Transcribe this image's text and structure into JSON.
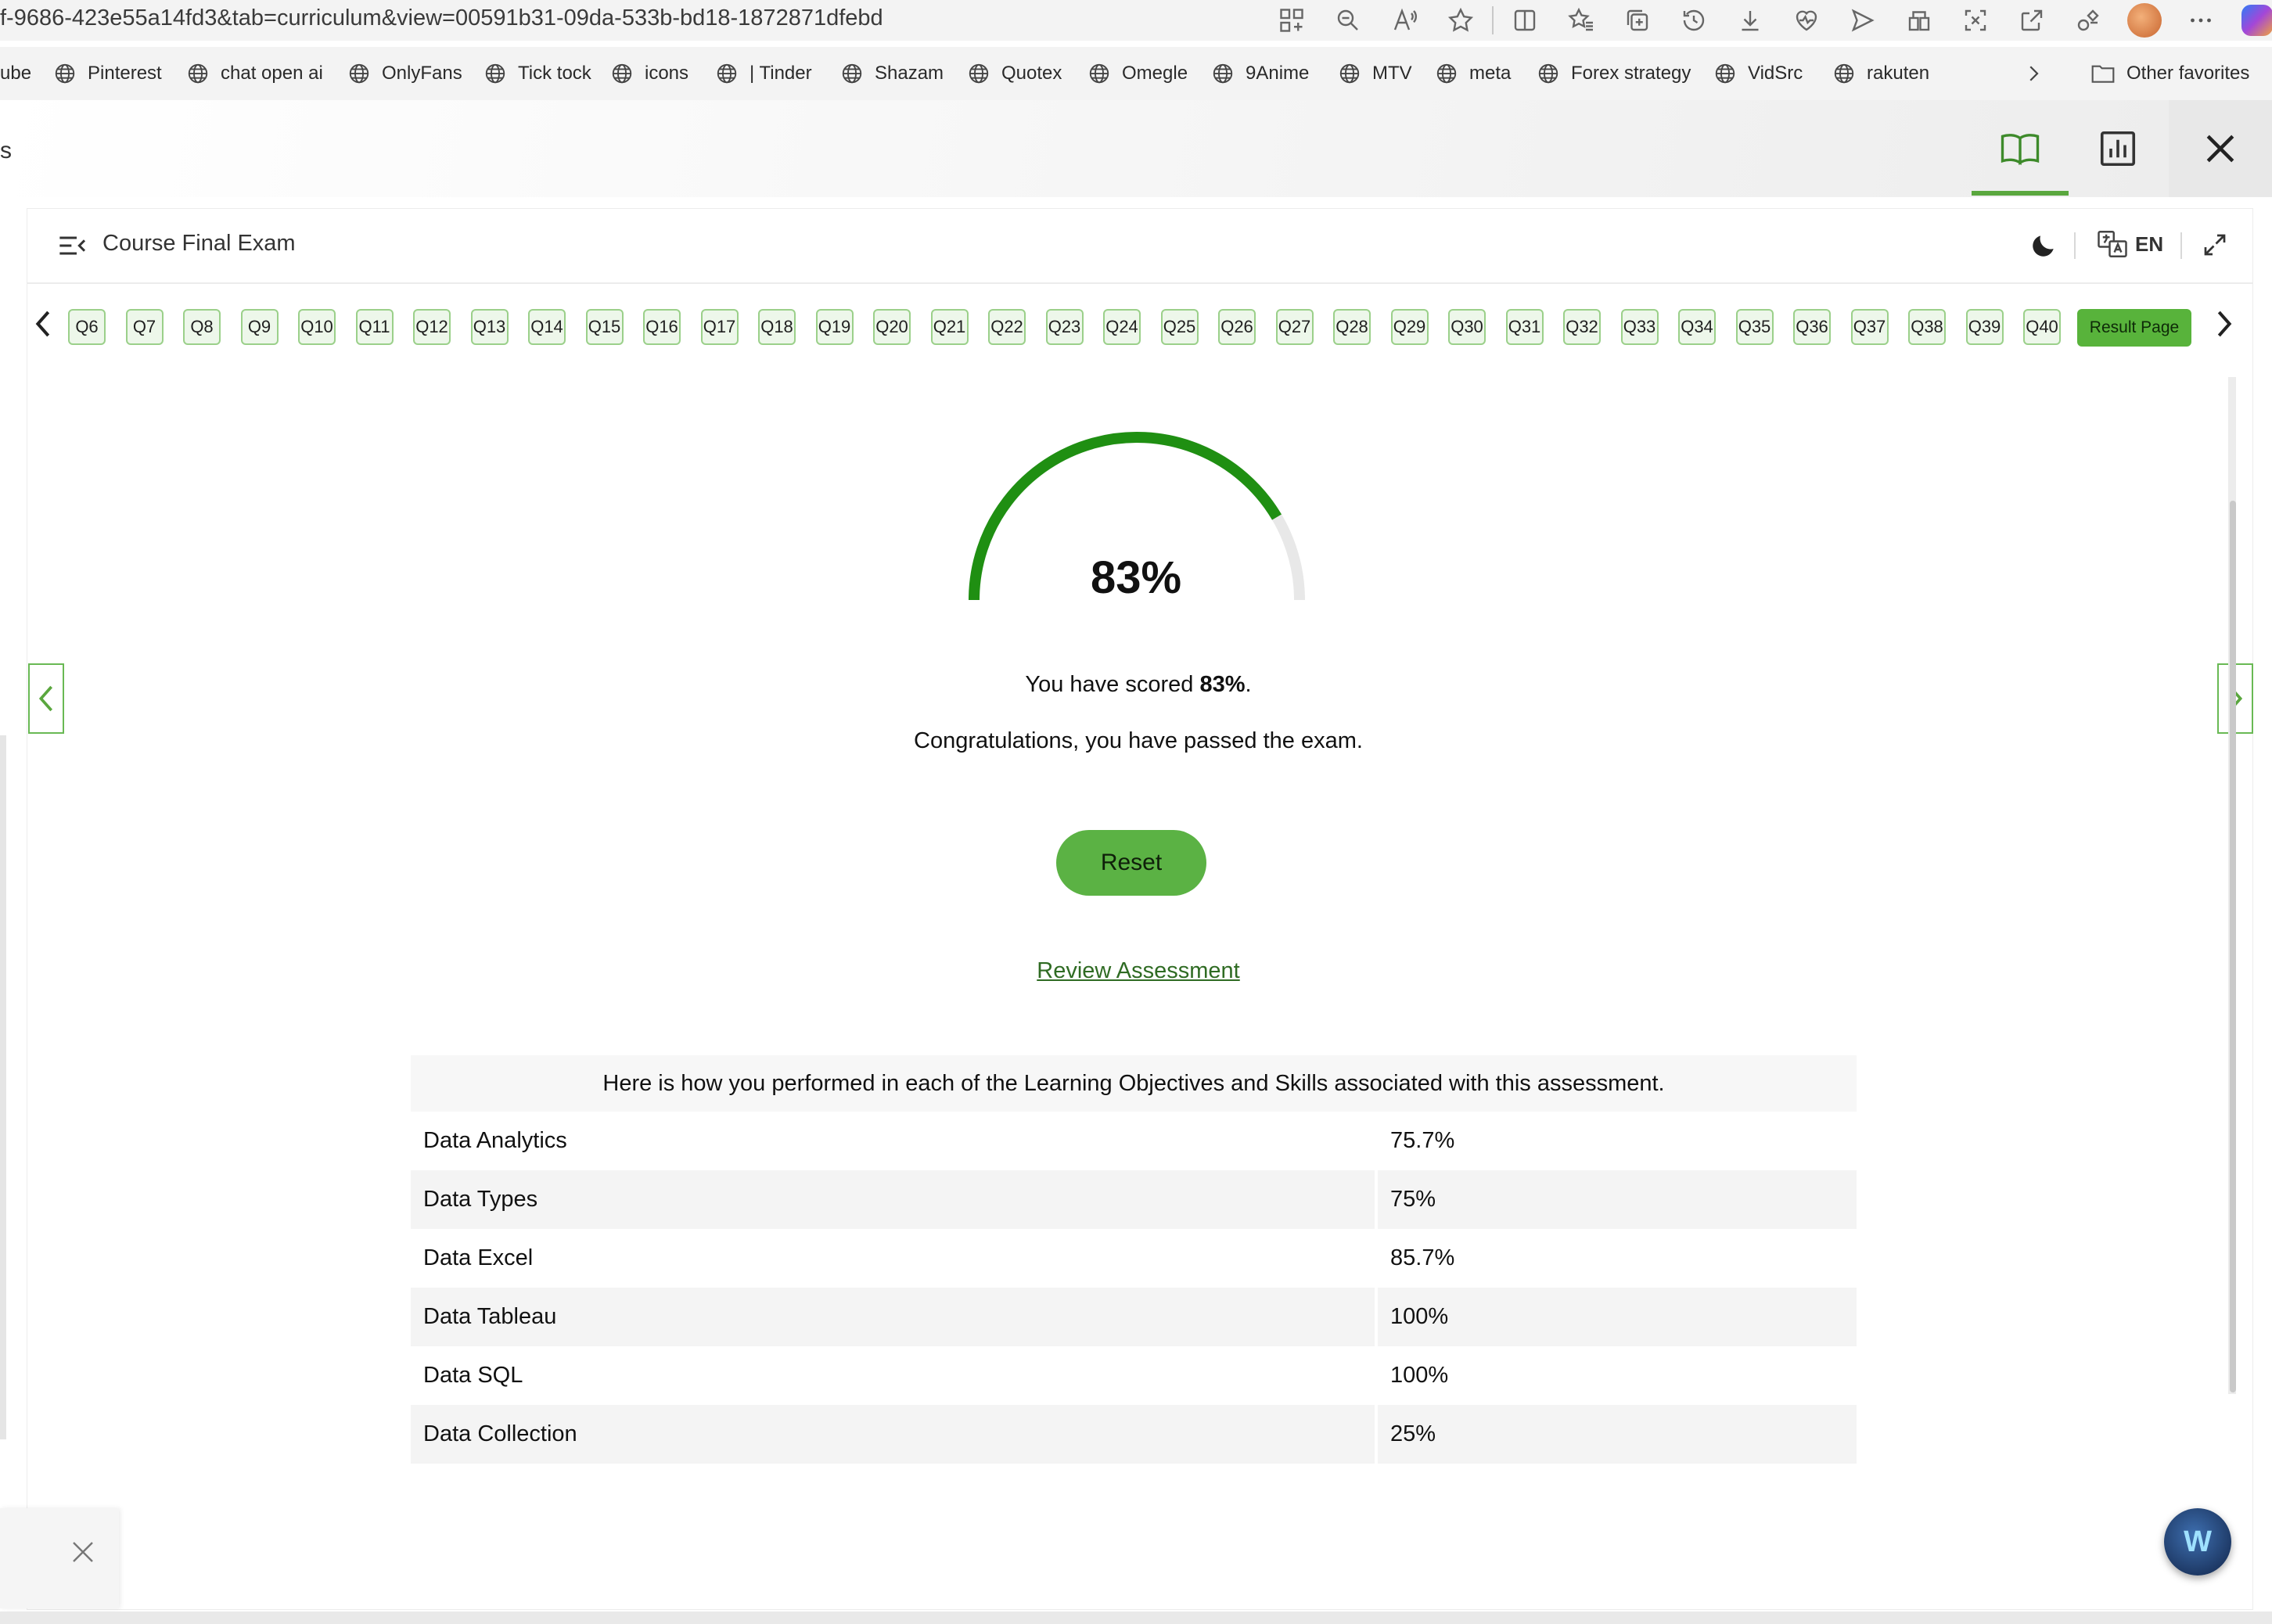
{
  "browser": {
    "url": "f-9686-423e55a14fd3&tab=curriculum&view=00591b31-09da-533b-bd18-1872871dfebd",
    "bookmarks": [
      "ube",
      "Pinterest",
      "chat open ai",
      "OnlyFans",
      "Tick tock",
      "icons",
      "| Tinder",
      "Shazam",
      "Quotex",
      "Omegle",
      "9Anime",
      "MTV",
      "meta",
      "Forex strategy",
      "VidSrc",
      "rakuten"
    ],
    "other_favorites": "Other favorites"
  },
  "app": {
    "header_fragment": "s"
  },
  "exam": {
    "title": "Course Final Exam",
    "language": "EN",
    "questions": [
      "Q6",
      "Q7",
      "Q8",
      "Q9",
      "Q10",
      "Q11",
      "Q12",
      "Q13",
      "Q14",
      "Q15",
      "Q16",
      "Q17",
      "Q18",
      "Q19",
      "Q20",
      "Q21",
      "Q22",
      "Q23",
      "Q24",
      "Q25",
      "Q26",
      "Q27",
      "Q28",
      "Q29",
      "Q30",
      "Q31",
      "Q32",
      "Q33",
      "Q34",
      "Q35",
      "Q36",
      "Q37",
      "Q38",
      "Q39",
      "Q40"
    ],
    "result_page_label": "Result Page"
  },
  "result": {
    "score_percent": 83,
    "score_text": "83%",
    "scored_prefix": "You have scored ",
    "scored_value": "83%",
    "scored_suffix": ".",
    "congrats": "Congratulations, you have passed the exam.",
    "reset_label": "Reset",
    "review_label": "Review Assessment"
  },
  "performance": {
    "heading": "Here is how you performed in each of the Learning Objectives and Skills associated with this assessment.",
    "rows": [
      {
        "name": "Data Analytics",
        "value": "75.7%"
      },
      {
        "name": "Data Types",
        "value": "75%"
      },
      {
        "name": "Data Excel",
        "value": "85.7%"
      },
      {
        "name": "Data Tableau",
        "value": "100%"
      },
      {
        "name": "Data SQL",
        "value": "100%"
      },
      {
        "name": "Data Collection",
        "value": "25%"
      }
    ]
  },
  "colors": {
    "accent": "#5bb244",
    "gauge_fill": "#1f8f12",
    "gauge_track": "#e8e8e8",
    "link": "#2f6b23"
  },
  "icons": {
    "fab": "widget-assistant-icon"
  }
}
